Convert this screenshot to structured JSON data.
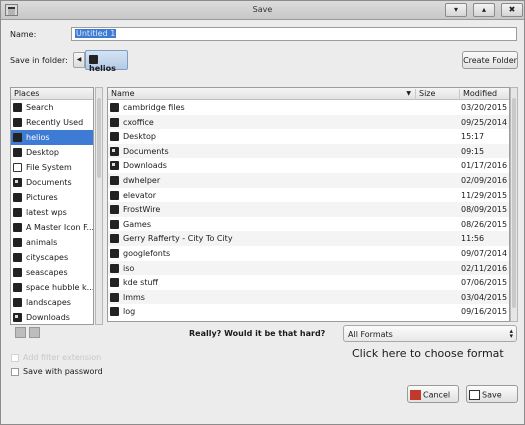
{
  "window": {
    "title": "Save",
    "buttons": [
      "▾",
      "▴",
      "✖"
    ]
  },
  "name_label": "Name:",
  "name_value": "Untitled 1",
  "save_in_label": "Save in folder:",
  "current_folder": "helios",
  "create_folder_label": "Create Folder",
  "places": {
    "header": "Places",
    "items": [
      {
        "label": "Search",
        "icon": "search-icon"
      },
      {
        "label": "Recently Used",
        "icon": "clock-icon"
      },
      {
        "label": "helios",
        "icon": "home-folder-icon"
      },
      {
        "label": "Desktop",
        "icon": "desktop-icon"
      },
      {
        "label": "File System",
        "icon": "drive-icon"
      },
      {
        "label": "Documents",
        "icon": "folder-icon"
      },
      {
        "label": "Pictures",
        "icon": "folder-icon"
      },
      {
        "label": "latest wps",
        "icon": "folder-icon"
      },
      {
        "label": "A Master Icon F...",
        "icon": "folder-icon"
      },
      {
        "label": "animals",
        "icon": "folder-icon"
      },
      {
        "label": "cityscapes",
        "icon": "folder-icon"
      },
      {
        "label": "seascapes",
        "icon": "folder-icon"
      },
      {
        "label": "space hubble k...",
        "icon": "folder-icon"
      },
      {
        "label": "landscapes",
        "icon": "folder-icon"
      },
      {
        "label": "Downloads",
        "icon": "folder-icon"
      },
      {
        "label": "",
        "icon": "folder-icon"
      }
    ]
  },
  "files": {
    "columns": {
      "name": "Name",
      "size": "Size",
      "modified": "Modified",
      "sort_indicator": "▼"
    },
    "rows": [
      {
        "name": "cambridge files",
        "modified": "03/20/2015"
      },
      {
        "name": "cxoffice",
        "modified": "09/25/2014"
      },
      {
        "name": "Desktop",
        "modified": "15:17"
      },
      {
        "name": "Documents",
        "modified": "09:15"
      },
      {
        "name": "Downloads",
        "modified": "01/17/2016"
      },
      {
        "name": "dwhelper",
        "modified": "02/09/2016"
      },
      {
        "name": "elevator",
        "modified": "11/29/2015"
      },
      {
        "name": "FrostWire",
        "modified": "08/09/2015"
      },
      {
        "name": "Games",
        "modified": "08/26/2015"
      },
      {
        "name": "Gerry Rafferty - City To City",
        "modified": "11:56"
      },
      {
        "name": "googlefonts",
        "modified": "09/07/2014"
      },
      {
        "name": "iso",
        "modified": "02/11/2016"
      },
      {
        "name": "kde stuff",
        "modified": "07/06/2015"
      },
      {
        "name": "lmms",
        "modified": "03/04/2015"
      },
      {
        "name": "log",
        "modified": "09/16/2015"
      }
    ]
  },
  "prompt_text": "Really? Would it be that hard?",
  "format_select": {
    "value": "All Formats"
  },
  "format_hint": "Click here to choose format",
  "checkboxes": {
    "add_filter": "Add filter extension",
    "save_password": "Save with password"
  },
  "buttons": {
    "cancel": "Cancel",
    "save": "Save"
  },
  "colors": {
    "selection": "#3d7bd5",
    "cancel_icon": "#c0392b"
  }
}
